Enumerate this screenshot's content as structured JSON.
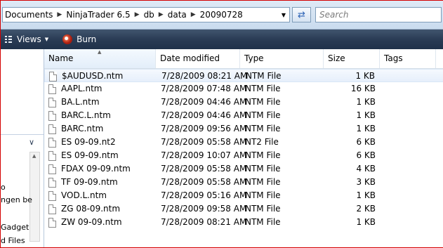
{
  "address": {
    "crumbs": [
      "Documents",
      "NinjaTrader 6.5",
      "db",
      "data",
      "20090728"
    ],
    "search_placeholder": "Search"
  },
  "toolbar": {
    "views_label": "Views",
    "burn_label": "Burn"
  },
  "leftpane": {
    "partial_items": [
      "o",
      "ngen be",
      "Gadget",
      "d Files"
    ]
  },
  "columns": {
    "name": "Name",
    "date": "Date modified",
    "type": "Type",
    "size": "Size",
    "tags": "Tags"
  },
  "files": [
    {
      "name": "$AUDUSD.ntm",
      "date": "7/28/2009 08:21 AM",
      "type": "NTM File",
      "size": "1 KB"
    },
    {
      "name": "AAPL.ntm",
      "date": "7/28/2009 07:48 AM",
      "type": "NTM File",
      "size": "16 KB"
    },
    {
      "name": "BA.L.ntm",
      "date": "7/28/2009 04:46 AM",
      "type": "NTM File",
      "size": "1 KB"
    },
    {
      "name": "BARC.L.ntm",
      "date": "7/28/2009 04:46 AM",
      "type": "NTM File",
      "size": "1 KB"
    },
    {
      "name": "BARC.ntm",
      "date": "7/28/2009 09:56 AM",
      "type": "NTM File",
      "size": "1 KB"
    },
    {
      "name": "ES 09-09.nt2",
      "date": "7/28/2009 05:58 AM",
      "type": "NT2 File",
      "size": "6 KB"
    },
    {
      "name": "ES 09-09.ntm",
      "date": "7/28/2009 10:07 AM",
      "type": "NTM File",
      "size": "6 KB"
    },
    {
      "name": "FDAX 09-09.ntm",
      "date": "7/28/2009 05:58 AM",
      "type": "NTM File",
      "size": "4 KB"
    },
    {
      "name": "TF 09-09.ntm",
      "date": "7/28/2009 05:58 AM",
      "type": "NTM File",
      "size": "3 KB"
    },
    {
      "name": "VOD.L.ntm",
      "date": "7/28/2009 05:16 AM",
      "type": "NTM File",
      "size": "1 KB"
    },
    {
      "name": "ZG 08-09.ntm",
      "date": "7/28/2009 09:58 AM",
      "type": "NTM File",
      "size": "2 KB"
    },
    {
      "name": "ZW 09-09.ntm",
      "date": "7/28/2009 08:21 AM",
      "type": "NTM File",
      "size": "1 KB"
    }
  ],
  "selected_index": 0
}
